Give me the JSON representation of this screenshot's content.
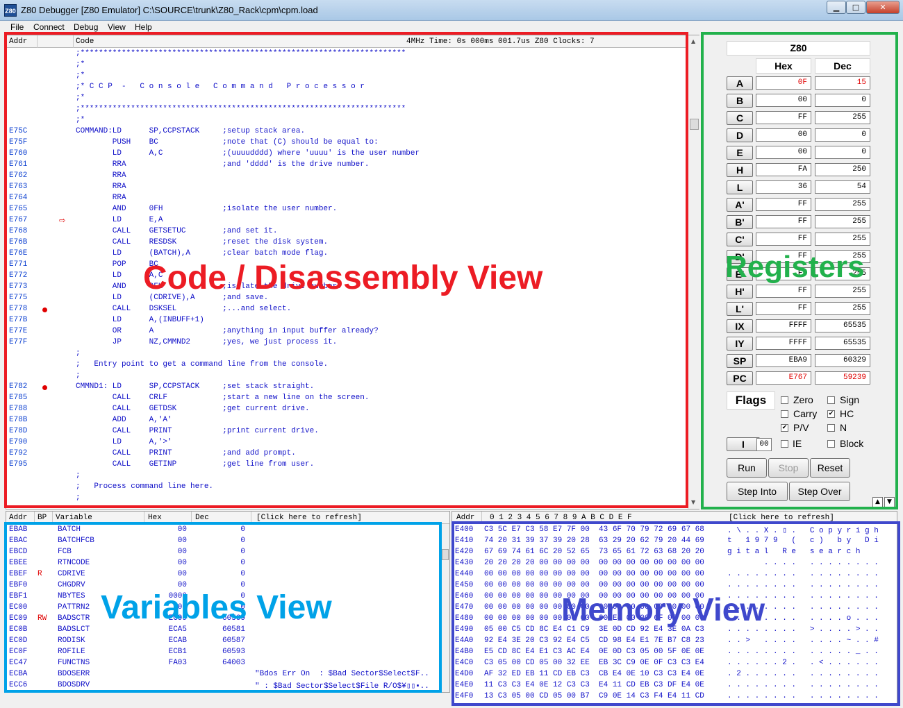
{
  "window": {
    "title": "Z80 Debugger [Z80 Emulator] C:\\SOURCE\\trunk\\Z80_Rack\\cpm\\cpm.load",
    "icon_text": "Z80",
    "minimize": "▁",
    "maximize": "□",
    "close": "✕"
  },
  "menu": [
    "File",
    "Connect",
    "Debug",
    "View",
    "Help"
  ],
  "code": {
    "header_addr": "Addr",
    "header_code": "Code",
    "header_status": "4MHz Time: 0s 000ms 001.7us  Z80 Clocks: 7",
    "lines": [
      {
        "a": "",
        "t": ";***********************************************************************"
      },
      {
        "a": "",
        "t": ";*"
      },
      {
        "a": "",
        "t": ";*"
      },
      {
        "a": "",
        "t": ";* C C P  -   C o n s o l e   C o m m a n d   P r o c e s s o r"
      },
      {
        "a": "",
        "t": ";*"
      },
      {
        "a": "",
        "t": ";***********************************************************************"
      },
      {
        "a": "",
        "t": ";*"
      },
      {
        "a": "E75C",
        "t": "COMMAND:LD      SP,CCPSTACK     ;setup stack area."
      },
      {
        "a": "E75F",
        "t": "        PUSH    BC              ;note that (C) should be equal to:"
      },
      {
        "a": "E760",
        "t": "        LD      A,C             ;(uuuudddd) where 'uuuu' is the user number"
      },
      {
        "a": "E761",
        "t": "        RRA                     ;and 'dddd' is the drive number."
      },
      {
        "a": "E762",
        "t": "        RRA"
      },
      {
        "a": "E763",
        "t": "        RRA"
      },
      {
        "a": "E764",
        "t": "        RRA"
      },
      {
        "a": "E765",
        "t": "        AND     0FH             ;isolate the user number."
      },
      {
        "a": "E767",
        "t": "        LD      E,A",
        "arrow": true
      },
      {
        "a": "E768",
        "t": "        CALL    GETSETUC        ;and set it."
      },
      {
        "a": "E76B",
        "t": "        CALL    RESDSK          ;reset the disk system."
      },
      {
        "a": "E76E",
        "t": "        LD      (BATCH),A       ;clear batch mode flag."
      },
      {
        "a": "E771",
        "t": "        POP     BC"
      },
      {
        "a": "E772",
        "t": "        LD      A,C"
      },
      {
        "a": "E773",
        "t": "        AND     0FH             ;isolate the drive number."
      },
      {
        "a": "E775",
        "t": "        LD      (CDRIVE),A      ;and save."
      },
      {
        "a": "E778",
        "t": "        CALL    DSKSEL          ;...and select.",
        "bp": true
      },
      {
        "a": "E77B",
        "t": "        LD      A,(INBUFF+1)"
      },
      {
        "a": "E77E",
        "t": "        OR      A               ;anything in input buffer already?"
      },
      {
        "a": "E77F",
        "t": "        JP      NZ,CMMND2       ;yes, we just process it."
      },
      {
        "a": "",
        "t": ";"
      },
      {
        "a": "",
        "t": ";   Entry point to get a command line from the console."
      },
      {
        "a": "",
        "t": ";"
      },
      {
        "a": "E782",
        "t": "CMMND1: LD      SP,CCPSTACK     ;set stack straight.",
        "bp": true
      },
      {
        "a": "E785",
        "t": "        CALL    CRLF            ;start a new line on the screen."
      },
      {
        "a": "E788",
        "t": "        CALL    GETDSK          ;get current drive."
      },
      {
        "a": "E78B",
        "t": "        ADD     A,'A'"
      },
      {
        "a": "E78D",
        "t": "        CALL    PRINT           ;print current drive."
      },
      {
        "a": "E790",
        "t": "        LD      A,'>'"
      },
      {
        "a": "E792",
        "t": "        CALL    PRINT           ;and add prompt."
      },
      {
        "a": "E795",
        "t": "        CALL    GETINP          ;get line from user."
      },
      {
        "a": "",
        "t": ";"
      },
      {
        "a": "",
        "t": ";   Process command line here."
      },
      {
        "a": "",
        "t": ";"
      }
    ],
    "arrow_glyph": "⇨"
  },
  "registers": {
    "title": "Z80",
    "hex_label": "Hex",
    "dec_label": "Dec",
    "rows": [
      {
        "name": "A",
        "hex": "0F",
        "dec": "15",
        "changed": true
      },
      {
        "name": "B",
        "hex": "00",
        "dec": "0"
      },
      {
        "name": "C",
        "hex": "FF",
        "dec": "255"
      },
      {
        "name": "D",
        "hex": "00",
        "dec": "0"
      },
      {
        "name": "E",
        "hex": "00",
        "dec": "0"
      },
      {
        "name": "H",
        "hex": "FA",
        "dec": "250"
      },
      {
        "name": "L",
        "hex": "36",
        "dec": "54"
      },
      {
        "name": "A'",
        "hex": "FF",
        "dec": "255"
      },
      {
        "name": "B'",
        "hex": "FF",
        "dec": "255"
      },
      {
        "name": "C'",
        "hex": "FF",
        "dec": "255"
      },
      {
        "name": "D'",
        "hex": "FF",
        "dec": "255"
      },
      {
        "name": "E'",
        "hex": "FF",
        "dec": "255"
      },
      {
        "name": "H'",
        "hex": "FF",
        "dec": "255"
      },
      {
        "name": "L'",
        "hex": "FF",
        "dec": "255"
      },
      {
        "name": "IX",
        "hex": "FFFF",
        "dec": "65535"
      },
      {
        "name": "IY",
        "hex": "FFFF",
        "dec": "65535"
      },
      {
        "name": "SP",
        "hex": "EBA9",
        "dec": "60329"
      },
      {
        "name": "PC",
        "hex": "E767",
        "dec": "59239",
        "changed": true
      }
    ],
    "flags_label": "Flags",
    "flags": [
      {
        "name": "Zero",
        "checked": false
      },
      {
        "name": "Sign",
        "checked": false
      },
      {
        "name": "Carry",
        "checked": false
      },
      {
        "name": "HC",
        "checked": true
      },
      {
        "name": "P/V",
        "checked": true
      },
      {
        "name": "N",
        "checked": false
      }
    ],
    "i_label": "I",
    "i_value": "00",
    "ie_label": "IE",
    "block_label": "Block",
    "buttons": {
      "run": "Run",
      "stop": "Stop",
      "reset": "Reset",
      "step_into": "Step Into",
      "step_over": "Step Over"
    },
    "up_glyph": "▲",
    "down_glyph": "▼"
  },
  "variables": {
    "headers": {
      "addr": "Addr",
      "bp": "BP",
      "variable": "Variable",
      "hex": "Hex",
      "dec": "Dec",
      "refresh": "[Click here to refresh]"
    },
    "rows": [
      {
        "addr": "EBAB",
        "bp": "",
        "name": "BATCH",
        "hex": "00",
        "dec": "0",
        "extra": ""
      },
      {
        "addr": "EBAC",
        "bp": "",
        "name": "BATCHFCB",
        "hex": "00",
        "dec": "0",
        "extra": ""
      },
      {
        "addr": "EBCD",
        "bp": "",
        "name": "FCB",
        "hex": "00",
        "dec": "0",
        "extra": ""
      },
      {
        "addr": "EBEE",
        "bp": "",
        "name": "RTNCODE",
        "hex": "00",
        "dec": "0",
        "extra": ""
      },
      {
        "addr": "EBEF",
        "bp": "R",
        "name": "CDRIVE",
        "hex": "00",
        "dec": "0",
        "extra": ""
      },
      {
        "addr": "EBF0",
        "bp": "",
        "name": "CHGDRV",
        "hex": "00",
        "dec": "0",
        "extra": ""
      },
      {
        "addr": "EBF1",
        "bp": "",
        "name": "NBYTES",
        "hex": "0000",
        "dec": "0",
        "extra": ""
      },
      {
        "addr": "EC00",
        "bp": "",
        "name": "PATTRN2",
        "hex": "00",
        "dec": "0",
        "extra": ""
      },
      {
        "addr": "EC09",
        "bp": "RW",
        "name": "BADSCTR",
        "hex": "EC99",
        "dec": "60569",
        "extra": ""
      },
      {
        "addr": "EC0B",
        "bp": "",
        "name": "BADSLCT",
        "hex": "ECA5",
        "dec": "60581",
        "extra": ""
      },
      {
        "addr": "EC0D",
        "bp": "",
        "name": "RODISK",
        "hex": "ECAB",
        "dec": "60587",
        "extra": ""
      },
      {
        "addr": "EC0F",
        "bp": "",
        "name": "ROFILE",
        "hex": "ECB1",
        "dec": "60593",
        "extra": ""
      },
      {
        "addr": "EC47",
        "bp": "",
        "name": "FUNCTNS",
        "hex": "FA03",
        "dec": "64003",
        "extra": ""
      },
      {
        "addr": "ECBA",
        "bp": "",
        "name": "BDOSERR",
        "hex": "",
        "dec": "",
        "extra": "\"Bdos Err On  : $Bad Sector$Select$F.."
      },
      {
        "addr": "ECC6",
        "bp": "",
        "name": "BDOSDRV",
        "hex": "",
        "dec": "",
        "extra": "\" : $Bad Sector$Select$File R/O$¥▯▯▪.."
      }
    ]
  },
  "memory": {
    "header_addr": "Addr",
    "header_cols": "0  1  2  3  4  5  6  7   8  9  A  B  C  D  E  F",
    "header_refresh": "[Click here to refresh]",
    "rows": [
      {
        "addr": "E400",
        "hex": "C3 5C E7 C3 58 E7 7F 00  43 6F 70 79 72 69 67 68",
        "ascii": ". \\ . . X . ▯ .   C o p y r i g h"
      },
      {
        "addr": "E410",
        "hex": "74 20 31 39 37 39 20 28  63 29 20 62 79 20 44 69",
        "ascii": "t   1 9 7 9   (   c )   b y   D i"
      },
      {
        "addr": "E420",
        "hex": "67 69 74 61 6C 20 52 65  73 65 61 72 63 68 20 20",
        "ascii": "g i t a l   R e   s e a r c h"
      },
      {
        "addr": "E430",
        "hex": "20 20 20 20 00 00 00 00  00 00 00 00 00 00 00 00",
        "ascii": "        . . . .   . . . . . . . ."
      },
      {
        "addr": "E440",
        "hex": "00 00 00 00 00 00 00 00  00 00 00 00 00 00 00 00",
        "ascii": ". . . . . . . .   . . . . . . . ."
      },
      {
        "addr": "E450",
        "hex": "00 00 00 00 00 00 00 00  00 00 00 00 00 00 00 00",
        "ascii": ". . . . . . . .   . . . . . . . ."
      },
      {
        "addr": "E460",
        "hex": "00 00 00 00 00 00 00 00  00 00 00 00 00 00 00 00",
        "ascii": ". . . . . . . .   . . . . . . . ."
      },
      {
        "addr": "E470",
        "hex": "00 00 00 00 00 00 00 00  00 00 00 00 00 00 00 00",
        "ascii": ". . . . . . . .   . . . . . . . ."
      },
      {
        "addr": "E480",
        "hex": "00 00 00 00 00 00 00 00  00 E4 00 00 6F 0E 00 00",
        "ascii": ". . . . . . . .   . . . . o . . ."
      },
      {
        "addr": "E490",
        "hex": "05 00 C5 CD 8C E4 C1 C9  3E 0D CD 92 E4 3E 0A C3",
        "ascii": ". . . . . . . .   > . . . . > . ."
      },
      {
        "addr": "E4A0",
        "hex": "92 E4 3E 20 C3 92 E4 C5  CD 98 E4 E1 7E B7 C8 23",
        "ascii": ". . >   . . . .   . . . . ~ . . #"
      },
      {
        "addr": "E4B0",
        "hex": "E5 CD 8C E4 E1 C3 AC E4  0E 0D C3 05 00 5F 0E 0E",
        "ascii": ". . . . . . . .   . . . . . _ . ."
      },
      {
        "addr": "E4C0",
        "hex": "C3 05 00 CD 05 00 32 EE  EB 3C C9 0E 0F C3 C3 E4",
        "ascii": ". . . . . . 2 .   . < . . . . . ."
      },
      {
        "addr": "E4D0",
        "hex": "AF 32 ED EB 11 CD EB C3  CB E4 0E 10 C3 C3 E4 0E",
        "ascii": ". 2 . . . . . .   . . . . . . . ."
      },
      {
        "addr": "E4E0",
        "hex": "11 C3 C3 E4 0E 12 C3 C3  E4 11 CD EB C3 DF E4 0E",
        "ascii": ". . . . . . . .   . . . . . . . ."
      },
      {
        "addr": "E4F0",
        "hex": "13 C3 05 00 CD 05 00 B7  C9 0E 14 C3 F4 E4 11 CD",
        "ascii": ". . . . . . . .   . . . . . . . ."
      }
    ]
  },
  "annotations": {
    "code": "Code / Disassembly View",
    "registers": "Registers",
    "variables": "Variables View",
    "memory": "Memory View"
  },
  "annotation_colors": {
    "code": "#ec1c24",
    "registers": "#22b14c",
    "variables": "#00a2e8",
    "memory": "#3f48cc"
  }
}
